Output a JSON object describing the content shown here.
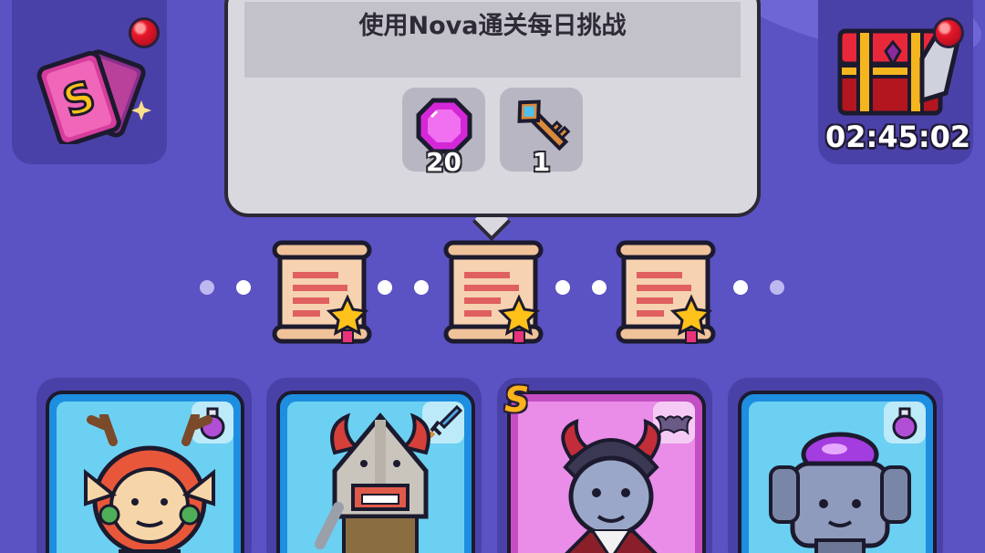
{
  "daily_challenge": {
    "title": "使用Nova通关每日挑战",
    "rewards": [
      {
        "icon": "gem-icon",
        "count": "20"
      },
      {
        "icon": "key-icon",
        "count": "1"
      }
    ]
  },
  "chest": {
    "timer": "02:45:02"
  },
  "cards_button": {
    "rank_letter": "S",
    "has_notification": true
  },
  "progress": {
    "scrolls": 3,
    "dots": 8
  },
  "heroes": [
    {
      "name": "antlered-elf",
      "class_icon": "potion-icon",
      "rarity": "blue",
      "rank": ""
    },
    {
      "name": "horned-knight",
      "class_icon": "sword-icon",
      "rarity": "blue",
      "rank": ""
    },
    {
      "name": "vampire",
      "class_icon": "bat-icon",
      "rarity": "pink",
      "rank": "S"
    },
    {
      "name": "purple-golem",
      "class_icon": "potion-icon",
      "rarity": "blue",
      "rank": ""
    }
  ],
  "colors": {
    "background": "#5b52c4",
    "panel": "#4a41a8",
    "card_blue": "#1e8ee0",
    "card_pink": "#c44ec2"
  }
}
